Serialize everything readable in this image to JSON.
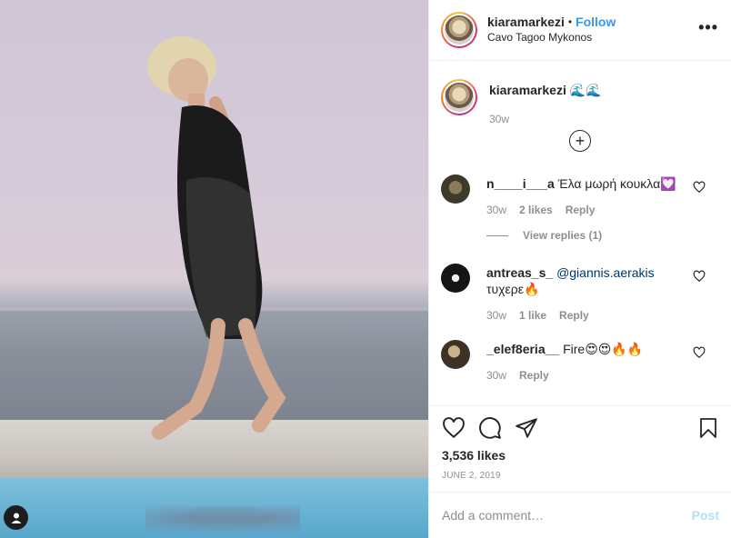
{
  "post": {
    "username": "kiaramarkezi",
    "follow_label": "Follow",
    "separator": "•",
    "location": "Cavo Tagoo Mykonos",
    "more_label": "•••",
    "caption_text": "🌊🌊",
    "caption_age": "30w",
    "load_more_label": "+"
  },
  "comments": [
    {
      "username": "n____i___a",
      "text": "Έλα μωρή κουκλα💟",
      "mention": "",
      "age": "30w",
      "likes": "2 likes",
      "reply_label": "Reply",
      "view_replies": "View replies (1)"
    },
    {
      "username": "antreas_s_",
      "mention": "@giannis.aerakis",
      "text": "τυχερε🔥",
      "age": "30w",
      "likes": "1 like",
      "reply_label": "Reply"
    },
    {
      "username": "_elef8eria__",
      "text": "Fire😍😍🔥🔥",
      "mention": "",
      "age": "30w",
      "likes": "",
      "reply_label": "Reply"
    }
  ],
  "actions": {
    "likes": "3,536 likes",
    "date": "JUNE 2, 2019"
  },
  "composer": {
    "placeholder": "Add a comment…",
    "post_label": "Post"
  },
  "icons": {
    "more": "more-options-icon",
    "load_more": "plus-circle-icon",
    "like": "heart-icon",
    "comment": "comment-icon",
    "share": "share-icon",
    "save": "bookmark-icon",
    "user_tag": "user-tag-icon"
  },
  "colors": {
    "accent": "#3897f0",
    "post_disabled": "#b2dffc",
    "muted": "#8e8e8e",
    "mention": "#003569"
  }
}
